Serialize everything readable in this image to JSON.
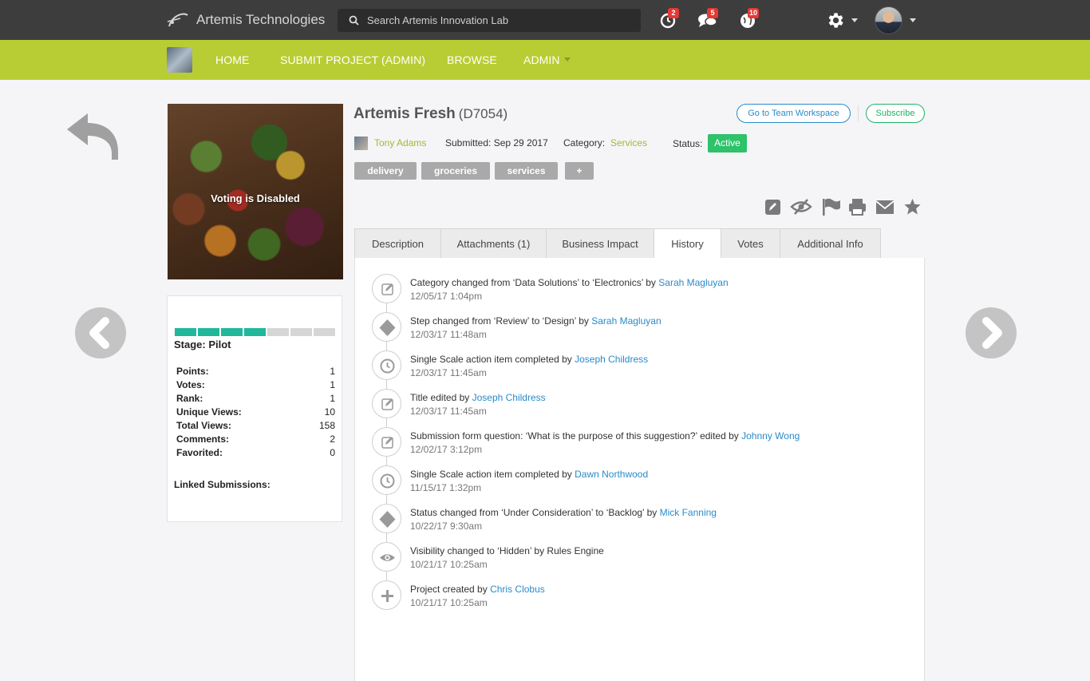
{
  "header": {
    "brand": "Artemis Technologies",
    "search_placeholder": "Search Artemis Innovation Lab",
    "badges": {
      "activity": "2",
      "messages": "5",
      "notifications": "10"
    }
  },
  "nav": {
    "home": "HOME",
    "submit": "SUBMIT PROJECT (ADMIN)",
    "browse": "BROWSE",
    "admin": "ADMIN"
  },
  "project": {
    "title": "Artemis Fresh",
    "code": "(D7054)",
    "author": "Tony Adams",
    "submitted": "Submitted: Sep 29 2017",
    "category_label": "Category:",
    "category": "Services",
    "status_label": "Status:",
    "status": "Active",
    "tags": [
      "delivery",
      "groceries",
      "services",
      "+"
    ],
    "voting_text": "Voting is Disabled",
    "team_button": "Go to Team Workspace",
    "subscribe_button": "Subscribe"
  },
  "stats": {
    "progress_filled": 4,
    "progress_total": 7,
    "stage": "Stage: Pilot",
    "rows": [
      {
        "label": "Points:",
        "value": "1"
      },
      {
        "label": "Votes:",
        "value": "1"
      },
      {
        "label": "Rank:",
        "value": "1"
      },
      {
        "label": "Unique Views:",
        "value": "10"
      },
      {
        "label": "Total Views:",
        "value": "158"
      },
      {
        "label": "Comments:",
        "value": "2"
      },
      {
        "label": "Favorited:",
        "value": "0"
      }
    ],
    "linked": "Linked Submissions:"
  },
  "tabs": [
    "Description",
    "Attachments (1)",
    "Business Impact",
    "History",
    "Votes",
    "Additional Info"
  ],
  "history": [
    {
      "icon": "edit",
      "text": "Category changed from ‘Data Solutions’ to ‘Electronics’ by ",
      "user": "Sarah Magluyan",
      "date": "12/05/17 1:04pm"
    },
    {
      "icon": "diamond",
      "text": "Step changed from ‘Review’ to ‘Design’ by ",
      "user": "Sarah Magluyan",
      "date": "12/03/17 11:48am"
    },
    {
      "icon": "clock",
      "text": "Single Scale action item completed by ",
      "user": "Joseph Childress",
      "date": "12/03/17 11:45am"
    },
    {
      "icon": "edit",
      "text": "Title edited by ",
      "user": "Joseph Childress",
      "date": "12/03/17 11:45am"
    },
    {
      "icon": "edit",
      "text": "Submission form question: ‘What is the purpose of this suggestion?’ edited by ",
      "user": "Johnny Wong",
      "date": "12/02/17 3:12pm"
    },
    {
      "icon": "clock",
      "text": "Single Scale action item completed by ",
      "user": "Dawn Northwood",
      "date": "11/15/17 1:32pm"
    },
    {
      "icon": "diamond",
      "text": "Status changed from ‘Under Consideration’ to ‘Backlog’ by ",
      "user": "Mick Fanning",
      "date": "10/22/17 9:30am"
    },
    {
      "icon": "eye",
      "text": "Visibility changed to ‘Hidden’ by Rules Engine",
      "user": "",
      "date": "10/21/17  10:25am"
    },
    {
      "icon": "plus",
      "text": "Project created by ",
      "user": "Chris Clobus",
      "date": "10/21/17 10:25am"
    }
  ]
}
